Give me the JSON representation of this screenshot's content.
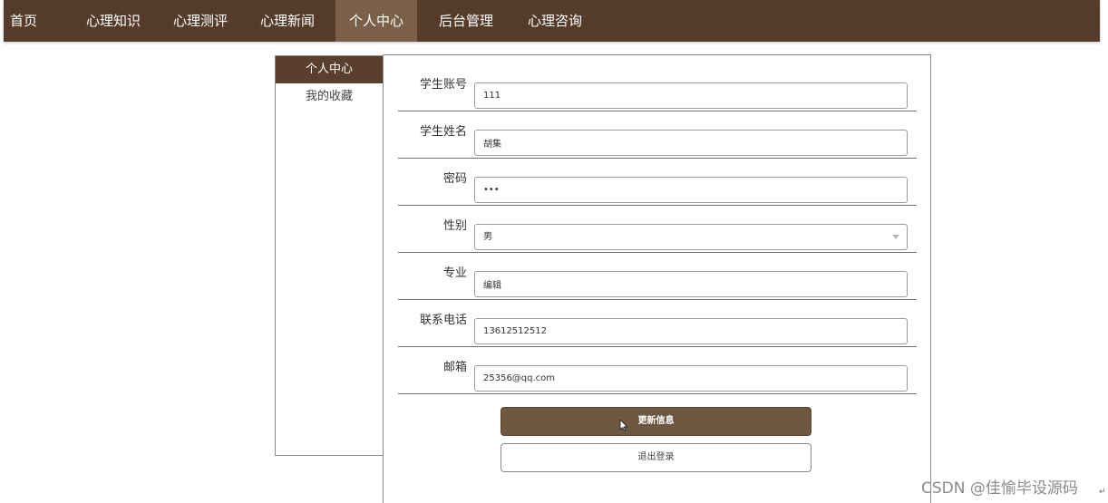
{
  "nav": {
    "items": [
      {
        "label": "首页"
      },
      {
        "label": "心理知识"
      },
      {
        "label": "心理测评"
      },
      {
        "label": "心理新闻"
      },
      {
        "label": "个人中心"
      },
      {
        "label": "后台管理"
      },
      {
        "label": "心理咨询"
      }
    ],
    "active_index": 4
  },
  "sidebar": {
    "items": [
      {
        "label": "个人中心"
      },
      {
        "label": "我的收藏"
      }
    ],
    "active_index": 0
  },
  "form": {
    "fields": [
      {
        "label": "学生账号",
        "value": "111"
      },
      {
        "label": "学生姓名",
        "value": "胡集"
      },
      {
        "label": "密码",
        "value": "•••"
      },
      {
        "label": "性别",
        "value": "男"
      },
      {
        "label": "专业",
        "value": "编辑"
      },
      {
        "label": "联系电话",
        "value": "13612512512"
      },
      {
        "label": "邮箱",
        "value": "25356@qq.com"
      }
    ],
    "update_label": "更新信息",
    "logout_label": "退出登录"
  },
  "watermark": "CSDN @佳愉毕设源码",
  "corner_mark": "↵",
  "colors": {
    "nav_bg": "#553b2a",
    "nav_active": "#7a6048",
    "sidebar_active": "#5a3f2c",
    "button_primary": "#6e5741"
  }
}
